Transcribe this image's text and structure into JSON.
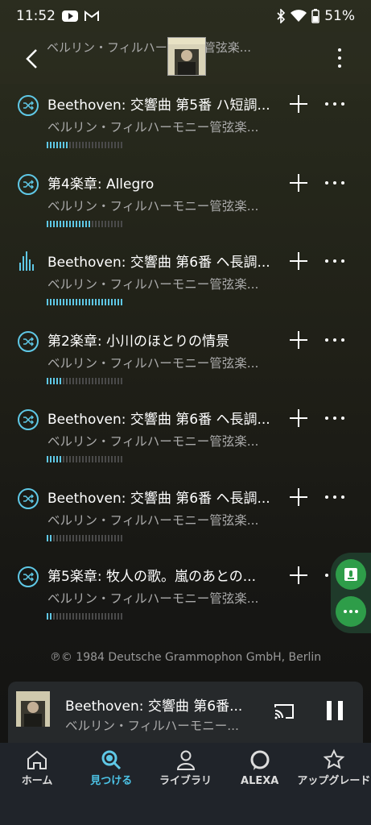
{
  "status_bar": {
    "time": "11:52",
    "battery": "51%"
  },
  "header": {
    "partial_subtitle": "ベルリン・フィルハーモニー管弦楽..."
  },
  "tracks": [
    {
      "title": "Beethoven: 交響曲 第5番 ハ短調...",
      "subtitle": "ベルリン・フィルハーモニー管弦楽...",
      "quality": 0.3,
      "playing": false
    },
    {
      "title": "第4楽章: Allegro",
      "subtitle": "ベルリン・フィルハーモニー管弦楽...",
      "quality": 0.6,
      "playing": false
    },
    {
      "title": "Beethoven: 交響曲 第6番 ヘ長調...",
      "subtitle": "ベルリン・フィルハーモニー管弦楽...",
      "quality": 1.0,
      "playing": true
    },
    {
      "title": "第2楽章: 小川のほとりの情景",
      "subtitle": "ベルリン・フィルハーモニー管弦楽...",
      "quality": 0.2,
      "playing": false
    },
    {
      "title": "Beethoven: 交響曲 第6番 ヘ長調...",
      "subtitle": "ベルリン・フィルハーモニー管弦楽...",
      "quality": 0.2,
      "playing": false
    },
    {
      "title": "Beethoven: 交響曲 第6番 ヘ長調...",
      "subtitle": "ベルリン・フィルハーモニー管弦楽...",
      "quality": 0.1,
      "playing": false
    },
    {
      "title": "第5楽章: 牧人の歌。嵐のあとの...",
      "subtitle": "ベルリン・フィルハーモニー管弦楽...",
      "quality": 0.1,
      "playing": false
    }
  ],
  "copyright": "℗© 1984 Deutsche Grammophon GmbH, Berlin",
  "mini_player": {
    "title": "Beethoven: 交響曲 第6番...",
    "subtitle": "ベルリン・フィルハーモニー..."
  },
  "nav": [
    {
      "label": "ホーム",
      "icon": "home-icon",
      "active": false
    },
    {
      "label": "見つける",
      "icon": "search-icon",
      "active": true
    },
    {
      "label": "ライブラリ",
      "icon": "person-icon",
      "active": false
    },
    {
      "label": "ALEXA",
      "icon": "alexa-icon",
      "active": false
    },
    {
      "label": "アップグレード",
      "icon": "star-icon",
      "active": false
    }
  ],
  "colors": {
    "accent": "#5fc8e6",
    "alexa_green": "#2e9d49"
  }
}
